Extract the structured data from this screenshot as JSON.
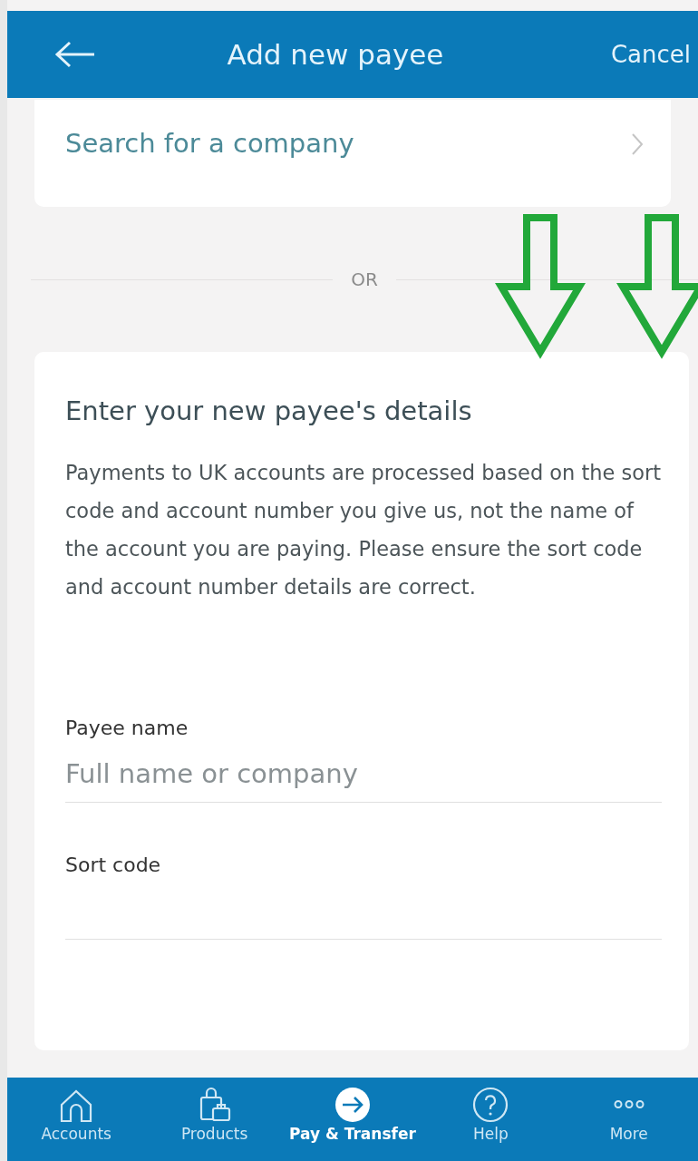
{
  "header": {
    "title": "Add new payee",
    "cancel": "Cancel"
  },
  "search_company": {
    "label": "Search for a company"
  },
  "divider": {
    "label": "OR"
  },
  "details": {
    "heading": "Enter your new payee's details",
    "note": "Payments to UK accounts are processed based on the sort code and account number you give us, not the name of the account you are paying. Please ensure the sort code and account number details are correct.",
    "fields": [
      {
        "label": "Payee name",
        "placeholder": "Full name or company"
      },
      {
        "label": "Sort code"
      }
    ]
  },
  "bottom_nav": [
    {
      "kind": "home",
      "label": "Accounts",
      "selected": false
    },
    {
      "kind": "bags",
      "label": "Products",
      "selected": false
    },
    {
      "kind": "arrow",
      "label": "Pay & Transfer",
      "selected": true
    },
    {
      "kind": "help",
      "label": "Help",
      "selected": false
    },
    {
      "kind": "more",
      "label": "More",
      "selected": false
    }
  ]
}
